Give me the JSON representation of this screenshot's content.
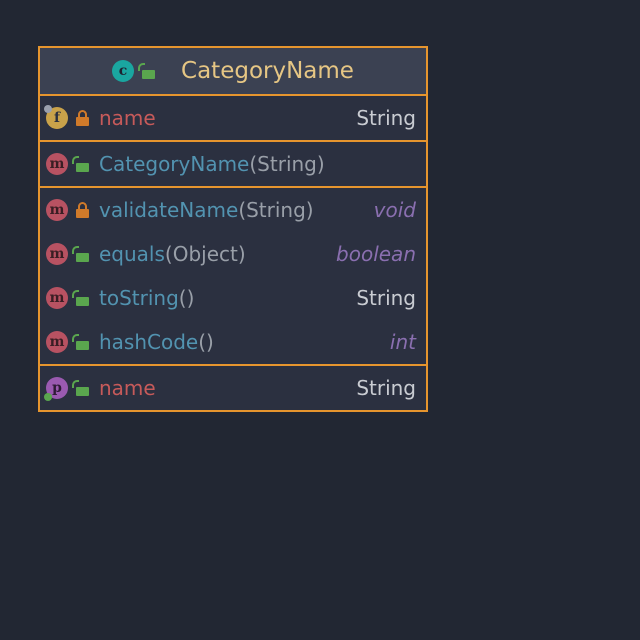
{
  "class": {
    "name": "CategoryName",
    "kind": "c",
    "open_lock": true
  },
  "fields": [
    {
      "badge": "f",
      "dot_tl": true,
      "lock": "orange",
      "lock_open": false,
      "name": "name",
      "name_color": "red",
      "type": "String",
      "kw": false
    }
  ],
  "constructors": [
    {
      "badge": "m",
      "lock": "green",
      "lock_open": true,
      "name": "CategoryName",
      "params": "(String)",
      "type": "",
      "kw": false
    }
  ],
  "methods": [
    {
      "badge": "m",
      "lock": "orange",
      "lock_open": false,
      "name": "validateName",
      "params": "(String)",
      "type": "void",
      "kw": true
    },
    {
      "badge": "m",
      "lock": "green",
      "lock_open": true,
      "name": "equals",
      "params": "(Object)",
      "type": "boolean",
      "kw": true
    },
    {
      "badge": "m",
      "lock": "green",
      "lock_open": true,
      "name": "toString",
      "params": "()",
      "type": "String",
      "kw": false
    },
    {
      "badge": "m",
      "lock": "green",
      "lock_open": true,
      "name": "hashCode",
      "params": "()",
      "type": "int",
      "kw": true
    }
  ],
  "properties": [
    {
      "badge": "p",
      "dot_bl_g": true,
      "lock": "green",
      "lock_open": true,
      "name": "name",
      "name_color": "red",
      "type": "String",
      "kw": false
    }
  ]
}
